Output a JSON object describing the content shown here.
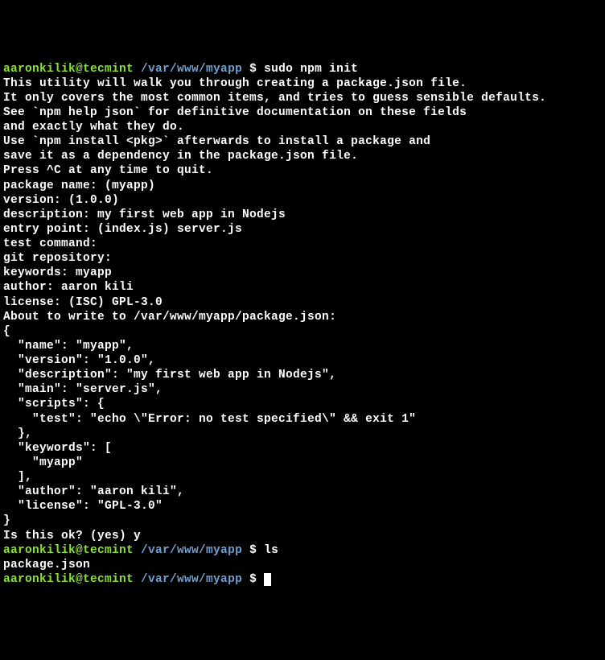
{
  "prompt1": {
    "user_host": "aaronkilik@tecmint",
    "path": "/var/www/myapp",
    "symbol": "$",
    "command": "sudo npm init"
  },
  "intro": [
    "This utility will walk you through creating a package.json file.",
    "It only covers the most common items, and tries to guess sensible defaults.",
    "",
    "See `npm help json` for definitive documentation on these fields",
    "and exactly what they do.",
    "",
    "Use `npm install <pkg>` afterwards to install a package and",
    "save it as a dependency in the package.json file.",
    "",
    "Press ^C at any time to quit."
  ],
  "fields": [
    "package name: (myapp)",
    "version: (1.0.0)",
    "description: my first web app in Nodejs",
    "entry point: (index.js) server.js",
    "test command:",
    "git repository:",
    "keywords: myapp",
    "author: aaron kili",
    "license: (ISC) GPL-3.0",
    "About to write to /var/www/myapp/package.json:"
  ],
  "json_output": [
    "",
    "{",
    "  \"name\": \"myapp\",",
    "  \"version\": \"1.0.0\",",
    "  \"description\": \"my first web app in Nodejs\",",
    "  \"main\": \"server.js\",",
    "  \"scripts\": {",
    "    \"test\": \"echo \\\"Error: no test specified\\\" && exit 1\"",
    "  },",
    "  \"keywords\": [",
    "    \"myapp\"",
    "  ],",
    "  \"author\": \"aaron kili\",",
    "  \"license\": \"GPL-3.0\"",
    "}",
    "",
    ""
  ],
  "confirm": "Is this ok? (yes) y",
  "prompt2": {
    "user_host": "aaronkilik@tecmint",
    "path": "/var/www/myapp",
    "symbol": "$",
    "command": "ls"
  },
  "ls_output": "package.json",
  "prompt3": {
    "user_host": "aaronkilik@tecmint",
    "path": "/var/www/myapp",
    "symbol": "$"
  }
}
